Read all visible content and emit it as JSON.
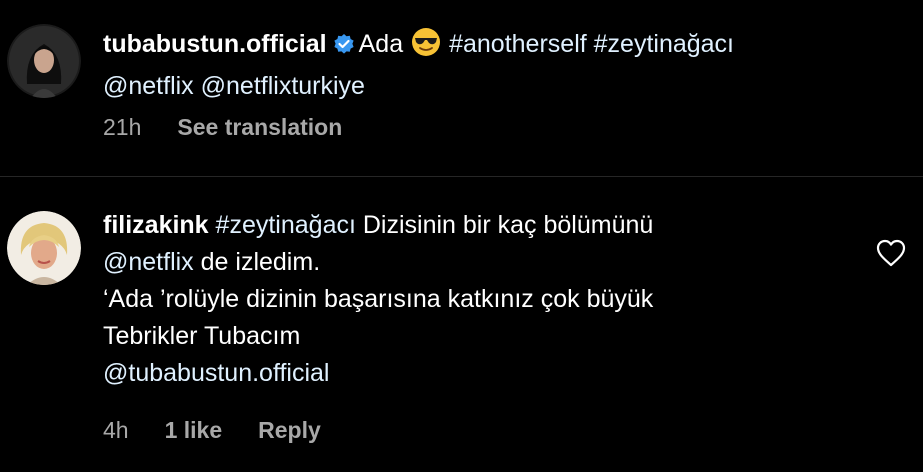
{
  "caption": {
    "username": "tubabustun.official",
    "text_before_emoji": "Ada",
    "hashtags": "#anotherself #zeytinağacı",
    "mentions": "@netflix @netflixturkiye",
    "time": "21h",
    "see_translation": "See translation",
    "verified_icon": "verified-badge-icon",
    "emoji": "smiling-face-with-sunglasses-emoji"
  },
  "comment": {
    "username": "filizakink",
    "hashtag": "#zeytinağacı",
    "line1_text": "Dizisinin bir kaç bölümünü",
    "mention_netflix": "@netflix",
    "line2_text": "de izledim.",
    "line3": "‘Ada ’rolüyle dizinin başarısına katkınız çok büyük",
    "line4": "Tebrikler Tubacım",
    "mention_tuba": "@tubabustun.official",
    "time": "4h",
    "likes": "1 like",
    "reply": "Reply",
    "like_icon": "heart-outline-icon"
  },
  "colors": {
    "background": "#000000",
    "text": "#ffffff",
    "link": "#e0f1ff",
    "meta": "#a8a8a8",
    "verified": "#3897f0",
    "divider": "#262626"
  }
}
